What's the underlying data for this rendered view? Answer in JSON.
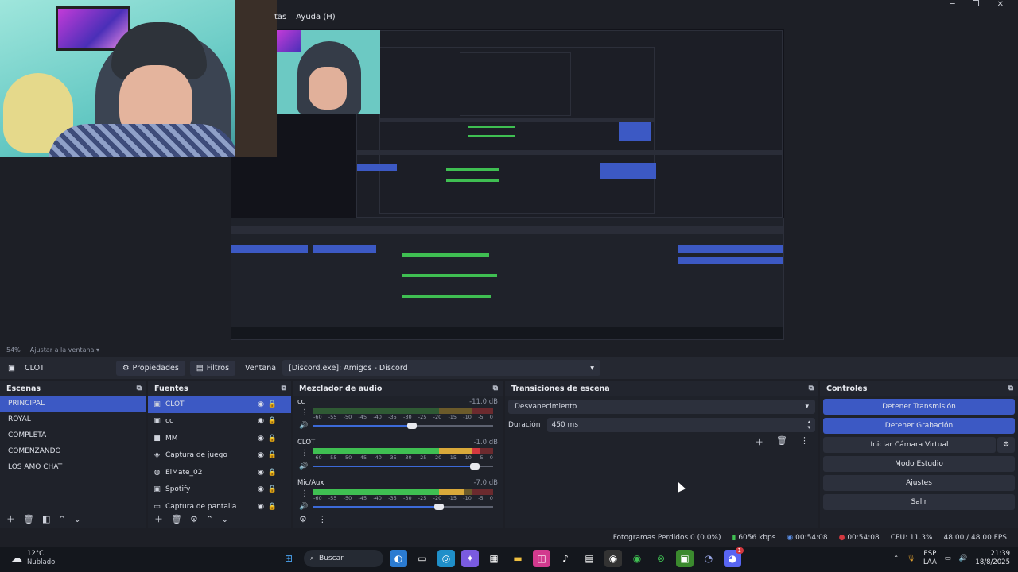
{
  "menu": {
    "herramientas_partial": "tas",
    "ayuda": "Ayuda (H)"
  },
  "preview": {
    "zoom": "54%",
    "fit_label": "Ajustar a la ventana"
  },
  "source_bar": {
    "source_name": "CLOT",
    "properties_label": "Propiedades",
    "filters_label": "Filtros",
    "window_label": "Ventana",
    "window_value": "[Discord.exe]: Amigos - Discord"
  },
  "scenes": {
    "title": "Escenas",
    "items": [
      "PRINCIPAL",
      "ROYAL",
      "COMPLETA",
      "COMENZANDO",
      "LOS AMO CHAT"
    ]
  },
  "sources": {
    "title": "Fuentes",
    "items": [
      {
        "label": "CLOT",
        "icon": "window-icon"
      },
      {
        "label": "cc",
        "icon": "window-icon"
      },
      {
        "label": "MM",
        "icon": "camera-icon"
      },
      {
        "label": "Captura de juego",
        "icon": "gamepad-icon"
      },
      {
        "label": "ElMate_02",
        "icon": "globe-icon"
      },
      {
        "label": "Spotify",
        "icon": "window-icon"
      },
      {
        "label": "Captura de pantalla",
        "icon": "monitor-icon"
      }
    ]
  },
  "mixer": {
    "title": "Mezclador de audio",
    "scale": [
      "-60",
      "-55",
      "-50",
      "-45",
      "-40",
      "-35",
      "-30",
      "-25",
      "-20",
      "-15",
      "-10",
      "-5",
      "0"
    ],
    "channels": [
      {
        "name": "cc",
        "db": "-11.0 dB",
        "level": 0.0,
        "volume": 0.55
      },
      {
        "name": "CLOT",
        "db": "-1.0 dB",
        "level": 0.93,
        "volume": 0.9
      },
      {
        "name": "Mic/Aux",
        "db": "-7.0 dB",
        "level": 0.84,
        "volume": 0.7
      }
    ]
  },
  "transitions": {
    "title": "Transiciones de escena",
    "selected": "Desvanecimiento",
    "duration_label": "Duración",
    "duration_value": "450 ms"
  },
  "controls": {
    "title": "Controles",
    "buttons": [
      "Detener Transmisión",
      "Detener Grabación",
      "Iniciar Cámara Virtual",
      "Modo Estudio",
      "Ajustes",
      "Salir"
    ]
  },
  "status": {
    "dropped": "Fotogramas Perdidos 0 (0.0%)",
    "bitrate": "6056 kbps",
    "stream_time": "00:54:08",
    "rec_time": "00:54:08",
    "cpu": "CPU: 11.3%",
    "fps": "48.00 / 48.00 FPS"
  },
  "taskbar": {
    "temp": "12°C",
    "weather": "Nublado",
    "search": "Buscar",
    "lang1": "ESP",
    "lang2": "LAA",
    "time": "21:39",
    "date": "18/8/2025",
    "discord_badge": "1"
  },
  "colors": {
    "accent": "#3c59c4",
    "green": "#3fbf52",
    "yellow": "#d9a93a",
    "red": "#d2383f"
  }
}
